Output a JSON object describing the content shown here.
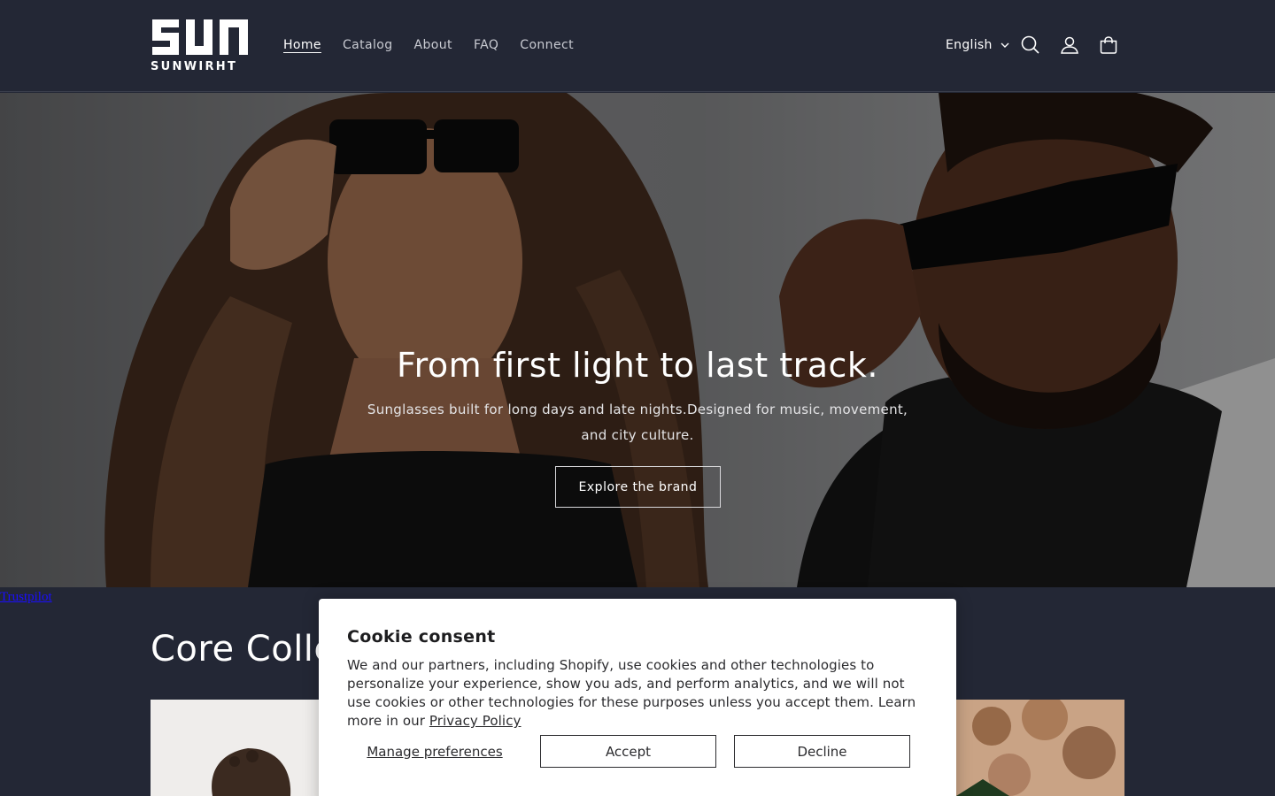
{
  "brand": {
    "name": "SUNWIRHT"
  },
  "nav": {
    "items": [
      {
        "label": "Home",
        "active": true
      },
      {
        "label": "Catalog"
      },
      {
        "label": "About"
      },
      {
        "label": "FAQ"
      },
      {
        "label": "Connect"
      }
    ]
  },
  "header": {
    "language": "English",
    "icons": [
      "search-icon",
      "account-icon",
      "cart-icon"
    ]
  },
  "hero": {
    "title": "From first light to last track.",
    "subtitle": "Sunglasses built for long days and late nights.Designed for music, movement, and city culture.",
    "button": "Explore the brand"
  },
  "trustpilot": {
    "label": "Trustpilot"
  },
  "collection": {
    "title": "Core Collection"
  },
  "cookie": {
    "title": "Cookie consent",
    "body": "We and our partners, including Shopify, use cookies and other technologies to personalize your experience, show you ads, and perform analytics, and we will not use cookies or other technologies for these purposes unless you accept them. Learn more in our ",
    "policy_link": "Privacy Policy",
    "manage_label": "Manage preferences",
    "accept_label": "Accept",
    "decline_label": "Decline"
  },
  "colors": {
    "background": "#232735",
    "link": "#1a0dff"
  }
}
